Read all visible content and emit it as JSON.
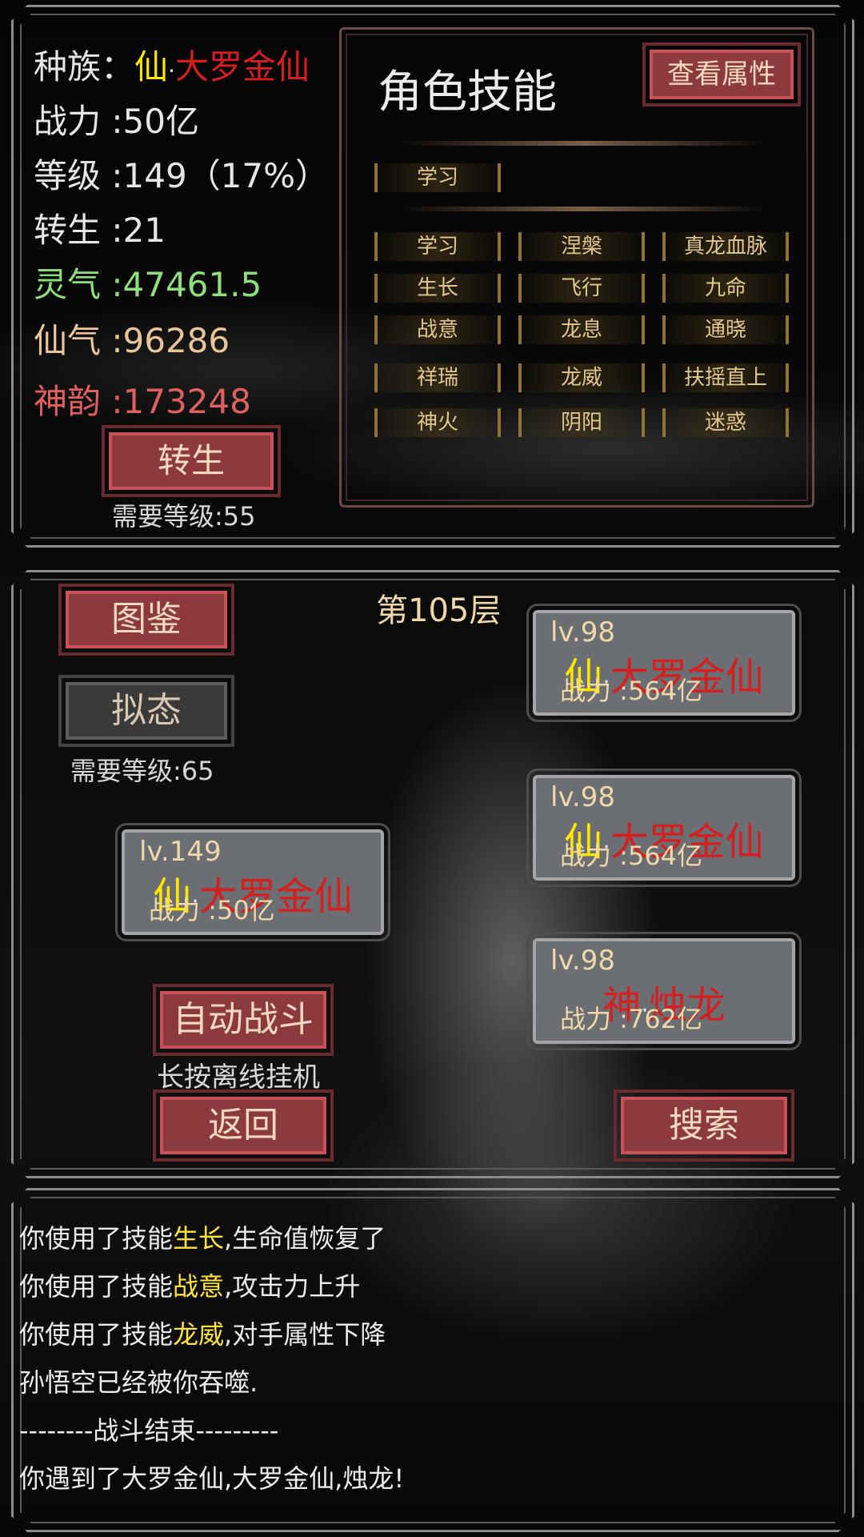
{
  "stats": {
    "race_label": "种族：",
    "race_prefix": "仙",
    "race_dot": "·",
    "race_rank": "大罗金仙",
    "power": "战力 :50亿",
    "level": "等级 :149（17%）",
    "rebirth": "转生 :21",
    "lingqi": "灵气 :47461.5",
    "xianqi": "仙气 :96286",
    "shenyun": "神韵 :173248",
    "rebirth_button": "转生",
    "rebirth_req": "需要等级:55"
  },
  "skills_panel": {
    "title": "角色技能",
    "view_attr_button": "查看属性",
    "active_skills": [
      "学习"
    ],
    "skills": [
      "学习",
      "涅槃",
      "真龙血脉",
      "生长",
      "飞行",
      "九命",
      "战意",
      "龙息",
      "通晓",
      "祥瑞",
      "龙威",
      "扶摇直上",
      "神火",
      "阴阳",
      "迷惑"
    ]
  },
  "battle": {
    "floor": "第105层",
    "codex_button": "图鉴",
    "mimic_button": "拟态",
    "mimic_req": "需要等级:65",
    "auto_battle_button": "自动战斗",
    "auto_hint": "长按离线挂机",
    "back_button": "返回",
    "search_button": "搜索",
    "player": {
      "lv": "lv.149",
      "race": "仙",
      "dot": "·",
      "rank": "大罗金仙",
      "power": "战力 :50亿"
    },
    "enemies": [
      {
        "lv": "lv.98",
        "race": "仙",
        "dot": "·",
        "rank": "大罗金仙",
        "power": "战力 :564亿"
      },
      {
        "lv": "lv.98",
        "race": "仙",
        "dot": "·",
        "rank": "大罗金仙",
        "power": "战力 :564亿"
      },
      {
        "lv": "lv.98",
        "race": "神",
        "dot": "·",
        "rank": "烛龙",
        "power": "战力 :762亿"
      }
    ]
  },
  "log": {
    "line1_a": "你使用了技能",
    "line1_b": "生长",
    "line1_c": ",生命值恢复了",
    "line2_a": "你使用了技能",
    "line2_b": "战意",
    "line2_c": ",攻击力上升",
    "line3_a": "你使用了技能",
    "line3_b": "龙威",
    "line3_c": ",对手属性下降",
    "line4": "孙悟空已经被你吞噬.",
    "line5": "--------战斗结束---------",
    "line6": "你遇到了大罗金仙,大罗金仙,烛龙!"
  },
  "colors": {
    "red_button": "#8c3a3e",
    "rank_red": "#d71e1e",
    "race_yellow": "#ffe600",
    "lingqi_green": "#8ee07a",
    "xianqi_tan": "#e8c69a",
    "shenyun_red": "#e06060",
    "skill_gold": "#e3c88e"
  }
}
